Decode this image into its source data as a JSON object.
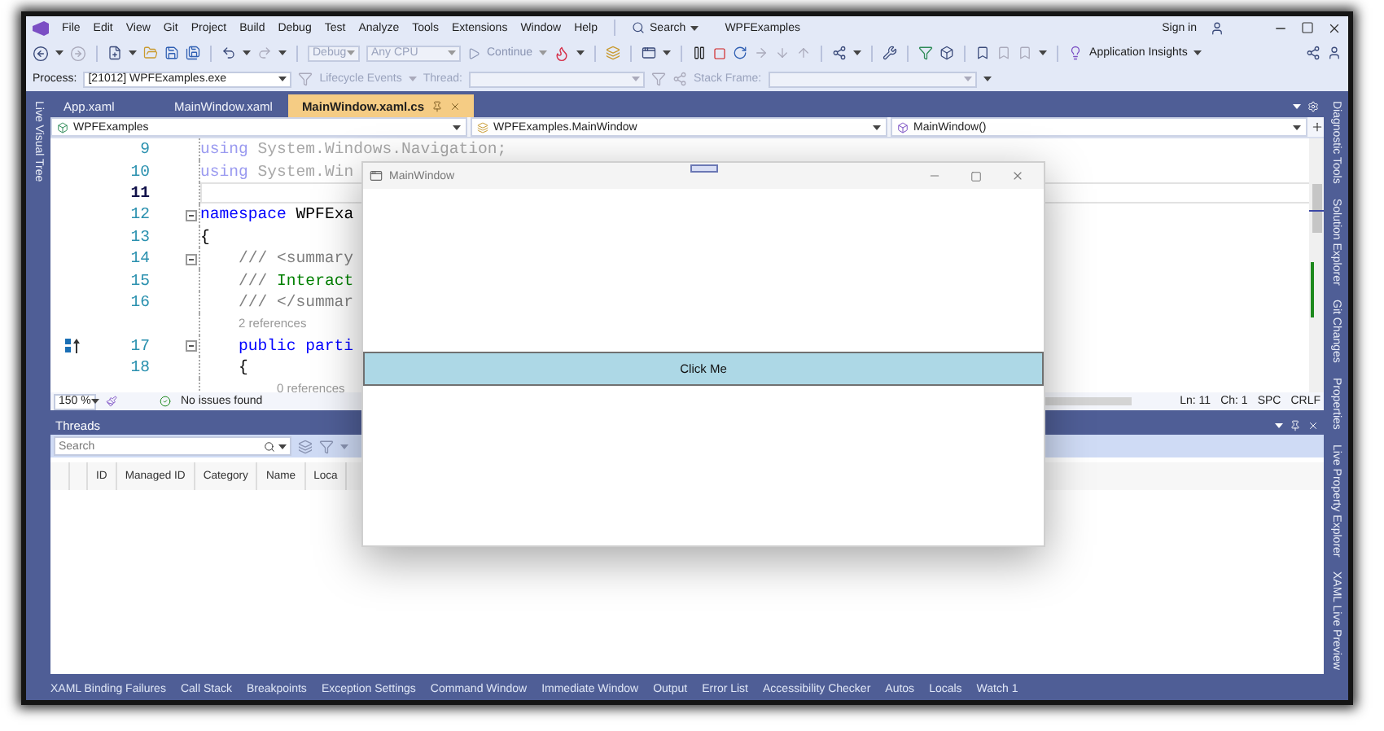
{
  "title_bar": {
    "menu": [
      "File",
      "Edit",
      "View",
      "Git",
      "Project",
      "Build",
      "Debug",
      "Test",
      "Analyze",
      "Tools",
      "Extensions",
      "Window",
      "Help"
    ],
    "search": "Search",
    "title": "WPFExamples",
    "sign_in": "Sign in"
  },
  "toolbar": {
    "configuration": "Debug",
    "platform": "Any CPU",
    "continue": "Continue",
    "insights": "Application Insights"
  },
  "debug_location": {
    "process_label": "Process:",
    "process": "[21012] WPFExamples.exe",
    "lifecycle": {
      "label": "Lifecycle Events",
      "disabled": true
    },
    "thread_label": "Thread:",
    "stack_frame_label": "Stack Frame:"
  },
  "left_sidebar": [
    "Live Visual Tree"
  ],
  "right_sidebar": [
    "Diagnostic Tools",
    "Solution Explorer",
    "Git Changes",
    "Properties",
    "Live Property Explorer",
    "XAML Live Preview"
  ],
  "editor": {
    "tabs": [
      {
        "label": "App.xaml",
        "selected": false
      },
      {
        "label": "MainWindow.xaml",
        "selected": false
      },
      {
        "label": "MainWindow.xaml.cs",
        "selected": true
      }
    ],
    "nav": [
      "WPFExamples",
      "WPFExamples.MainWindow",
      "MainWindow()"
    ],
    "lines": [
      {
        "kind": "code",
        "number": "9",
        "faded": true,
        "current": false,
        "fold": false,
        "tokens": [
          {
            "kind": "keyword",
            "text": "using"
          },
          {
            "kind": "plain",
            "text": " System.Windows.Navigation;"
          }
        ]
      },
      {
        "kind": "code",
        "number": "10",
        "faded": true,
        "current": false,
        "fold": false,
        "tokens": [
          {
            "kind": "keyword",
            "text": "using"
          },
          {
            "kind": "plain",
            "text": " System.Win"
          }
        ]
      },
      {
        "kind": "code",
        "number": "11",
        "faded": false,
        "current": true,
        "fold": false
      },
      {
        "kind": "code",
        "number": "12",
        "faded": false,
        "current": false,
        "fold": true,
        "tokens": [
          {
            "kind": "keyword",
            "text": "namespace"
          },
          {
            "kind": "plain",
            "text": " WPFExa"
          }
        ]
      },
      {
        "kind": "code",
        "number": "13",
        "faded": false,
        "current": false,
        "fold": false,
        "tokens": [
          {
            "kind": "plain",
            "text": "{"
          }
        ]
      },
      {
        "kind": "code",
        "number": "14",
        "faded": false,
        "current": false,
        "fold": true,
        "tokens": [
          {
            "kind": "doc",
            "text": "    /// <summary"
          }
        ]
      },
      {
        "kind": "code",
        "number": "15",
        "faded": false,
        "current": false,
        "fold": false,
        "tokens": [
          {
            "kind": "doc",
            "text": "    /// "
          },
          {
            "kind": "comment",
            "text": "Interact"
          }
        ]
      },
      {
        "kind": "code",
        "number": "16",
        "faded": false,
        "current": false,
        "fold": false,
        "tokens": [
          {
            "kind": "doc",
            "text": "    /// </summar"
          }
        ]
      },
      {
        "kind": "codelens",
        "text": "    2 references"
      },
      {
        "kind": "code",
        "number": "17",
        "faded": false,
        "current": false,
        "fold": true,
        "glyph": true,
        "tokens": [
          {
            "kind": "keyword",
            "text": "    public parti"
          }
        ]
      },
      {
        "kind": "code",
        "number": "18",
        "faded": false,
        "current": false,
        "fold": false,
        "tokens": [
          {
            "kind": "plain",
            "text": "    {"
          }
        ]
      },
      {
        "kind": "codelens",
        "text": "        0 references"
      }
    ],
    "status": {
      "zoom": "150 %",
      "issues": "No issues found",
      "line": "Ln: 11",
      "column": "Ch: 1",
      "spacing": "SPC",
      "line_ending": "CRLF"
    }
  },
  "threads": {
    "title": "Threads",
    "search_placeholder": "Search",
    "columns": [
      "ID",
      "Managed ID",
      "Category",
      "Name",
      "Loca"
    ]
  },
  "bottom_tabs": [
    "XAML Binding Failures",
    "Call Stack",
    "Breakpoints",
    "Exception Settings",
    "Command Window",
    "Immediate Window",
    "Output",
    "Error List",
    "Accessibility Checker",
    "Autos",
    "Locals",
    "Watch 1"
  ],
  "app_window": {
    "title": "MainWindow",
    "button": "Click Me"
  }
}
